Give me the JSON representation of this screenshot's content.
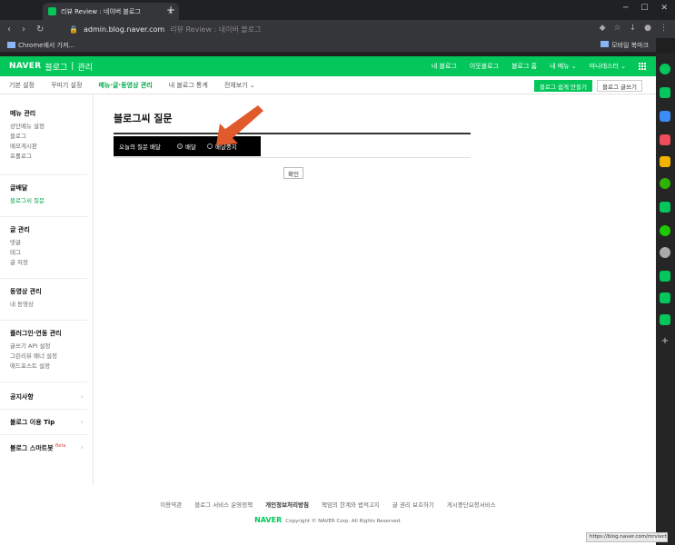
{
  "browser": {
    "tab_title": "리뷰 Review : 네이버 블로그",
    "tab_close": "×",
    "new_tab": "+",
    "url": "admin.blog.naver.com",
    "url_suffix": "리뷰 Review : 네이버 블로그",
    "bookmark_left": "Chrome에서 가져...",
    "bookmark_right": "모바일 북마크",
    "status_url": "https://blog.naver.com/mrviecter"
  },
  "header": {
    "logo": "NAVER",
    "logo_sub": "블로그",
    "admin": "관리",
    "links": [
      "내 블로그",
      "이웃블로그",
      "블로그 홈",
      "내 메뉴 ⌄",
      "마나데스터 ⌄"
    ]
  },
  "subnav": {
    "tabs": [
      "기본 설정",
      "꾸미기 설정",
      "메뉴·글·동영상 관리",
      "내 블로그 통계",
      "전체보기 ⌄"
    ],
    "active_index": 2,
    "btn_make": "블로그 쉽게 만들기",
    "btn_write": "블로그 글쓰기"
  },
  "sidebar": {
    "menu_title": "메뉴 관리",
    "menu_items": [
      "상단메뉴 설정",
      "블로그",
      "메모게시판",
      "프롤로그"
    ],
    "delivery_title": "글배달",
    "delivery_items": [
      "블로그씨 질문"
    ],
    "post_title": "글 관리",
    "post_items": [
      "댓글",
      "태그",
      "글 저장"
    ],
    "video_title": "동영상 관리",
    "video_items": [
      "내 동영상"
    ],
    "plugin_title": "플러그인·연동 관리",
    "plugin_items": [
      "글쓰기 API 설정",
      "그린리뷰 배너 설정",
      "애드포스트 설정"
    ],
    "notice": "공지사항",
    "tip": "블로그 이용 Tip",
    "smartbot": "블로그 스마트봇",
    "beta": "Beta"
  },
  "main": {
    "title": "블로그씨 질문",
    "question_label": "오늘의 질문 배달",
    "radio_on": "배달",
    "radio_off": "배달중지",
    "confirm": "확인"
  },
  "footer": {
    "links": [
      "이용약관",
      "블로그 서비스 운영정책",
      "개인정보처리방침",
      "책임의 한계와 법적고지",
      "글 권리 보호하기",
      "게시중단요청서비스"
    ],
    "copyright_brand": "NAVER",
    "copyright": "Copyright © NAVER Corp. All Rights Reserved."
  },
  "colors": {
    "brand": "#03c75a",
    "arrow": "#e05a2b"
  }
}
